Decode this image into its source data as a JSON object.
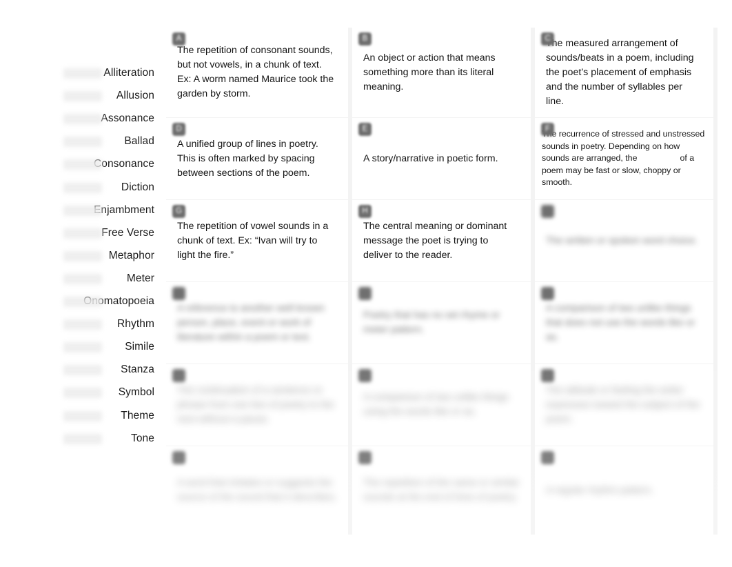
{
  "terms": [
    {
      "label": "Alliteration",
      "answer": ""
    },
    {
      "label": "Allusion",
      "answer": ""
    },
    {
      "label": "Assonance",
      "answer": ""
    },
    {
      "label": "Ballad",
      "answer": ""
    },
    {
      "label": "Consonance",
      "answer": ""
    },
    {
      "label": "Diction",
      "answer": ""
    },
    {
      "label": "Enjambment",
      "answer": ""
    },
    {
      "label": "Free Verse",
      "answer": ""
    },
    {
      "label": "Metaphor",
      "answer": ""
    },
    {
      "label": "Meter",
      "answer": ""
    },
    {
      "label": "Onomatopoeia",
      "answer": ""
    },
    {
      "label": "Rhythm",
      "answer": ""
    },
    {
      "label": "Simile",
      "answer": ""
    },
    {
      "label": "Stanza",
      "answer": ""
    },
    {
      "label": "Symbol",
      "answer": ""
    },
    {
      "label": "Theme",
      "answer": ""
    },
    {
      "label": "Tone",
      "answer": ""
    }
  ],
  "cards": [
    {
      "badge": "A",
      "text": "The repetition of consonant sounds, but not vowels, in a chunk of text. Ex: A worm named Maurice took the garden by storm.",
      "legible": true,
      "size": "normal"
    },
    {
      "badge": "B",
      "text": "An object or action that means something more than its literal meaning.",
      "legible": true,
      "size": "normal"
    },
    {
      "badge": "C",
      "text": "The measured arrangement of sounds/beats in a poem, including the poet’s placement of emphasis and the number of syllables per line.",
      "legible": true,
      "size": "normal"
    },
    {
      "badge": "D",
      "text": "A unified group of lines in poetry. This is often marked by spacing between sections of the poem.",
      "legible": true,
      "size": "normal"
    },
    {
      "badge": "E",
      "text": "A story/narrative in poetic form.",
      "legible": true,
      "size": "normal"
    },
    {
      "badge": "F",
      "text_before_blank": "The recurrence of stressed and unstressed sounds in poetry. Depending on how sounds are arranged, the",
      "text_after_blank": "of a poem may be fast or slow, choppy or smooth.",
      "has_blank": true,
      "legible": true,
      "size": "small"
    },
    {
      "badge": "G",
      "text": "The repetition of vowel sounds in a chunk of text. Ex: “Ivan will try to light the fire.”",
      "legible": true,
      "size": "normal"
    },
    {
      "badge": "H",
      "text": "The central meaning or dominant message the poet is trying to deliver to the reader.",
      "legible": true,
      "size": "normal"
    },
    {
      "badge": "I",
      "text": "The written or spoken word choice.",
      "legible": false,
      "size": "normal"
    },
    {
      "badge": "J",
      "text": "A reference to another well known person, place, event or work of literature within a poem or text.",
      "legible": false,
      "size": "normal"
    },
    {
      "badge": "K",
      "text": "Poetry that has no set rhyme or meter pattern.",
      "legible": false,
      "size": "normal"
    },
    {
      "badge": "L",
      "text": "A comparison of two unlike things that does not use the words like or as.",
      "legible": false,
      "size": "normal"
    },
    {
      "badge": "M",
      "text": "The continuation of a sentence or phrase from one line of poetry to the next without a pause.",
      "legible": false,
      "size": "normal"
    },
    {
      "badge": "N",
      "text": "A comparison of two unlike things using the words like or as.",
      "legible": false,
      "size": "normal"
    },
    {
      "badge": "O",
      "text": "The attitude or feeling the writer expresses toward the subject of the poem.",
      "legible": false,
      "size": "normal"
    },
    {
      "badge": "P",
      "text": "A word that imitates or suggests the source of the sound that it describes.",
      "legible": false,
      "size": "normal"
    },
    {
      "badge": "Q",
      "text": "The repetition of the same or similar sounds at the end of lines of poetry.",
      "legible": false,
      "size": "normal"
    },
    {
      "badge": "R",
      "text": "A regular rhythm pattern.",
      "legible": false,
      "size": "normal"
    }
  ],
  "colors": {
    "page_background": "#ffffff",
    "grid_background": "#f3f3f3",
    "card_background": "#ffffff",
    "badge_background": "#6d6d6d",
    "badge_text": "#ffffff",
    "body_text": "#151515"
  }
}
